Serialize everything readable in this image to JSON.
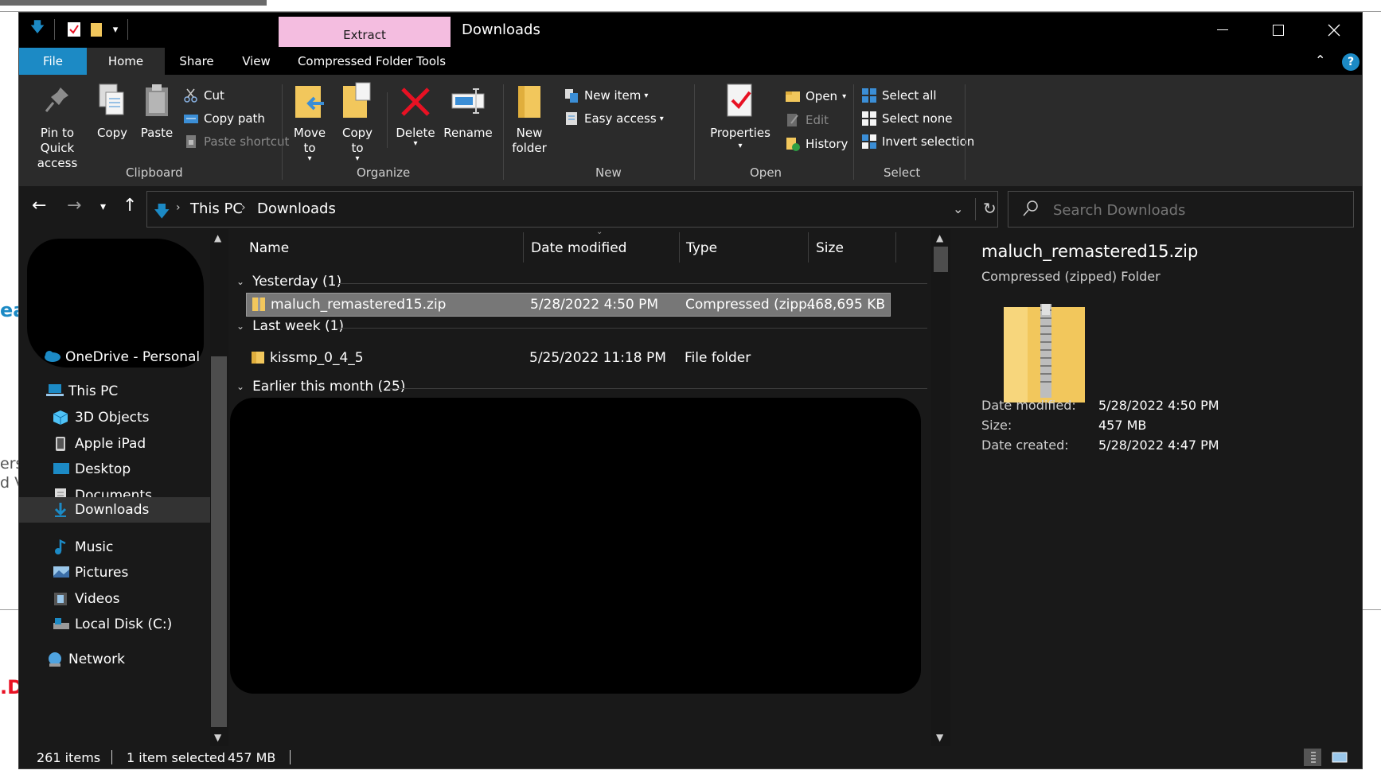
{
  "window": {
    "title": "Downloads"
  },
  "context_tab": {
    "label": "Extract",
    "group": "Compressed Folder Tools"
  },
  "ribbon_tabs": {
    "file": "File",
    "home": "Home",
    "share": "Share",
    "view": "View",
    "cft": "Compressed Folder Tools"
  },
  "ribbon": {
    "clipboard": {
      "label": "Clipboard",
      "pin": "Pin to Quick access",
      "pin_l1": "Pin to Quick",
      "pin_l2": "access",
      "copy": "Copy",
      "paste": "Paste",
      "cut": "Cut",
      "copy_path": "Copy path",
      "paste_shortcut": "Paste shortcut"
    },
    "organize": {
      "label": "Organize",
      "move_l1": "Move",
      "move_l2": "to",
      "copy_l1": "Copy",
      "copy_l2": "to",
      "delete": "Delete",
      "rename": "Rename"
    },
    "new": {
      "label": "New",
      "new_folder_l1": "New",
      "new_folder_l2": "folder",
      "new_item": "New item",
      "easy_access": "Easy access"
    },
    "open": {
      "label": "Open",
      "properties": "Properties",
      "open": "Open",
      "edit": "Edit",
      "history": "History"
    },
    "select": {
      "label": "Select",
      "select_all": "Select all",
      "select_none": "Select none",
      "invert": "Invert selection"
    }
  },
  "address": {
    "crumbs": [
      "This PC",
      "Downloads"
    ]
  },
  "search": {
    "placeholder": "Search Downloads"
  },
  "nav": {
    "onedrive": "OneDrive - Personal",
    "this_pc": "This PC",
    "items": [
      "3D Objects",
      "Apple iPad",
      "Desktop",
      "Documents",
      "Downloads",
      "Music",
      "Pictures",
      "Videos",
      "Local Disk (C:)"
    ],
    "network": "Network"
  },
  "columns": {
    "name": "Name",
    "date": "Date modified",
    "type": "Type",
    "size": "Size"
  },
  "groups": [
    {
      "label": "Yesterday (1)",
      "files": [
        {
          "name": "maluch_remastered15.zip",
          "date": "5/28/2022 4:50 PM",
          "type": "Compressed (zipp...",
          "size": "468,695 KB"
        }
      ]
    },
    {
      "label": "Last week (1)",
      "files": [
        {
          "name": "kissmp_0_4_5",
          "date": "5/25/2022 11:18 PM",
          "type": "File folder",
          "size": ""
        }
      ]
    },
    {
      "label": "Earlier this month (25)"
    }
  ],
  "preview": {
    "name": "maluch_remastered15.zip",
    "type": "Compressed (zipped) Folder",
    "date_modified_label": "Date modified:",
    "date_modified": "5/28/2022 4:50 PM",
    "size_label": "Size:",
    "size": "457 MB",
    "date_created_label": "Date created:",
    "date_created": "5/28/2022 4:47 PM"
  },
  "status": {
    "items": "261 items",
    "selected": "1 item selected",
    "size": "457 MB"
  },
  "background_fragments": {
    "f1": "ea",
    "f2": "ers",
    "f3": "d V",
    "f4": ".D"
  },
  "colors": {
    "accent": "#1c8ac5",
    "context_tab": "#f4bde0",
    "folder": "#f2c75c",
    "delete": "#e81123"
  }
}
